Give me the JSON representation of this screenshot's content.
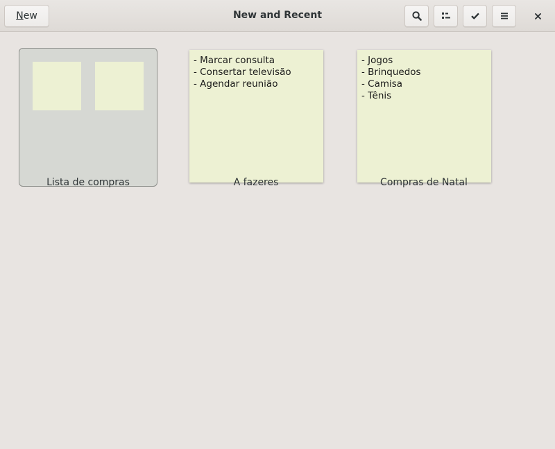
{
  "header": {
    "title": "New and Recent",
    "new_button": {
      "mnemonic": "N",
      "rest": "ew"
    },
    "icons": {
      "search": "search-icon",
      "view": "list-view-icon",
      "select": "checkmark-icon",
      "menu": "hamburger-menu-icon",
      "close": "close-icon"
    }
  },
  "colors": {
    "background": "#e8e4e1",
    "note": "#edf1d3",
    "notebook": "#d6d8d3"
  },
  "items": [
    {
      "type": "notebook",
      "label": "Lista de compras"
    },
    {
      "type": "note",
      "label": "A fazeres",
      "lines": [
        "- Marcar consulta",
        "- Consertar televisão",
        "- Agendar reunião"
      ]
    },
    {
      "type": "note",
      "label": "Compras de Natal",
      "lines": [
        "- Jogos",
        "- Brinquedos",
        "- Camisa",
        "- Tênis"
      ]
    }
  ]
}
